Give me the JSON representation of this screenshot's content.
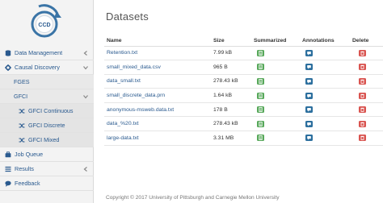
{
  "sidebar": {
    "logo_text": "CCD",
    "items": [
      {
        "label": "Data Management"
      },
      {
        "label": "Causal Discovery"
      },
      {
        "label": "FGES"
      },
      {
        "label": "GFCI"
      },
      {
        "label": "GFCI Continuous"
      },
      {
        "label": "GFCI Discrete"
      },
      {
        "label": "GFCI Mixed"
      },
      {
        "label": "Job Queue"
      },
      {
        "label": "Results"
      },
      {
        "label": "Feedback"
      }
    ]
  },
  "page": {
    "title": "Datasets"
  },
  "table": {
    "headers": {
      "name": "Name",
      "size": "Size",
      "summarized": "Summarized",
      "annotations": "Annotations",
      "delete": "Delete"
    },
    "rows": [
      {
        "name": "Retention.txt",
        "size": "7.99 kB"
      },
      {
        "name": "small_mixed_data.csv",
        "size": "965 B"
      },
      {
        "name": "data_small.txt",
        "size": "278.43 kB"
      },
      {
        "name": "small_discrete_data.prn",
        "size": "1.64 kB"
      },
      {
        "name": "anonymous-msweb.data.txt",
        "size": "178 B"
      },
      {
        "name": "data_%20.txt",
        "size": "278.43 kB"
      },
      {
        "name": "large-data.txt",
        "size": "3.31 MB"
      }
    ]
  },
  "footer": {
    "text": "Copyright © 2017 University of Pittsburgh and Carnegie Mellon University"
  },
  "colors": {
    "link": "#2a5a8f",
    "green": "#57a85a",
    "blue": "#2c6f9e",
    "red": "#d9534f",
    "logo_ring": "#3a74a6"
  }
}
